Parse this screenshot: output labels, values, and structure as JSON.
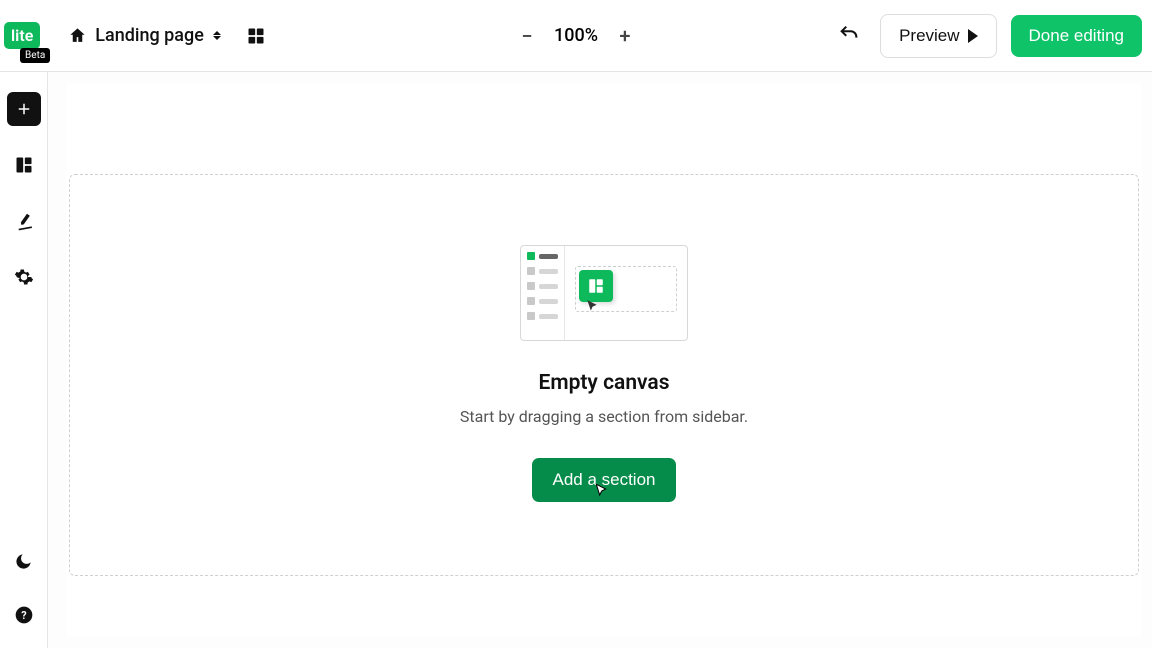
{
  "logo": {
    "text": "lite",
    "badge": "Beta"
  },
  "header": {
    "page_name": "Landing page",
    "zoom_level": "100%",
    "preview_label": "Preview",
    "done_label": "Done editing"
  },
  "sidebar": {
    "items": [
      {
        "name": "add"
      },
      {
        "name": "layouts"
      },
      {
        "name": "styles"
      },
      {
        "name": "settings"
      }
    ],
    "bottom": [
      {
        "name": "dark-mode"
      },
      {
        "name": "help"
      }
    ]
  },
  "canvas": {
    "empty_title": "Empty canvas",
    "empty_subtitle": "Start by dragging a section from sidebar.",
    "add_label": "Add a section"
  }
}
